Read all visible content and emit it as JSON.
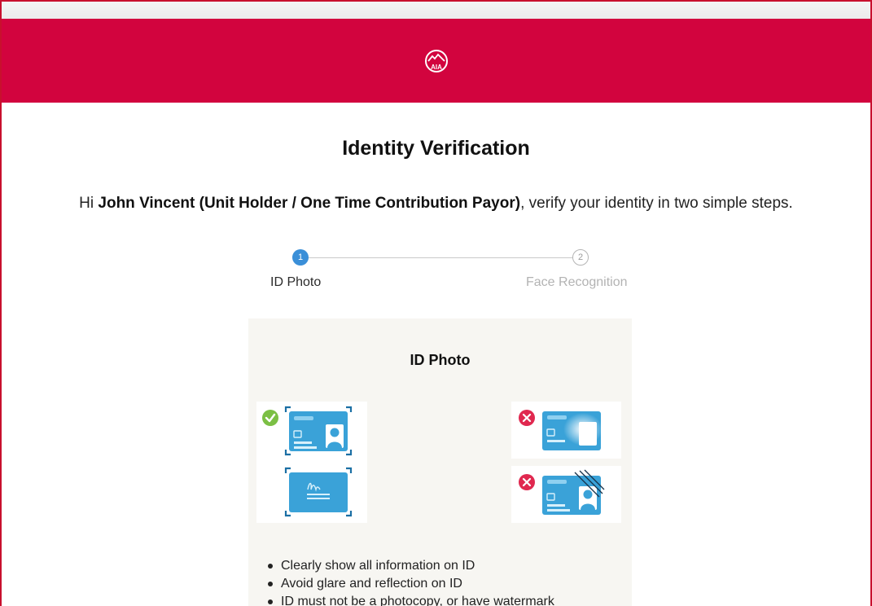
{
  "header": {
    "logo_icon": "aia-logo-icon",
    "brand_color": "#d2043e"
  },
  "page": {
    "title": "Identity Verification",
    "intro_prefix": "Hi ",
    "user_name": "John Vincent (Unit Holder / One Time Contribution Payor)",
    "intro_suffix": ", verify your identity in two simple steps."
  },
  "stepper": {
    "steps": [
      {
        "number": "1",
        "label": "ID Photo",
        "state": "active"
      },
      {
        "number": "2",
        "label": "Face Recognition",
        "state": "inactive"
      }
    ],
    "active_color": "#3a8fd8"
  },
  "card": {
    "title": "ID Photo",
    "examples": [
      {
        "kind": "good",
        "icon": "check-circle-icon",
        "images": [
          "id-card-front-icon",
          "id-card-back-signature-icon"
        ]
      },
      {
        "kind": "bad",
        "icon": "x-circle-icon",
        "images": [
          "id-card-glare-icon"
        ]
      },
      {
        "kind": "bad",
        "icon": "x-circle-icon",
        "images": [
          "id-card-watermark-icon"
        ]
      }
    ],
    "tips": [
      "Clearly show all information on ID",
      "Avoid glare and reflection on ID",
      "ID must not be a photocopy, or have watermark"
    ]
  }
}
